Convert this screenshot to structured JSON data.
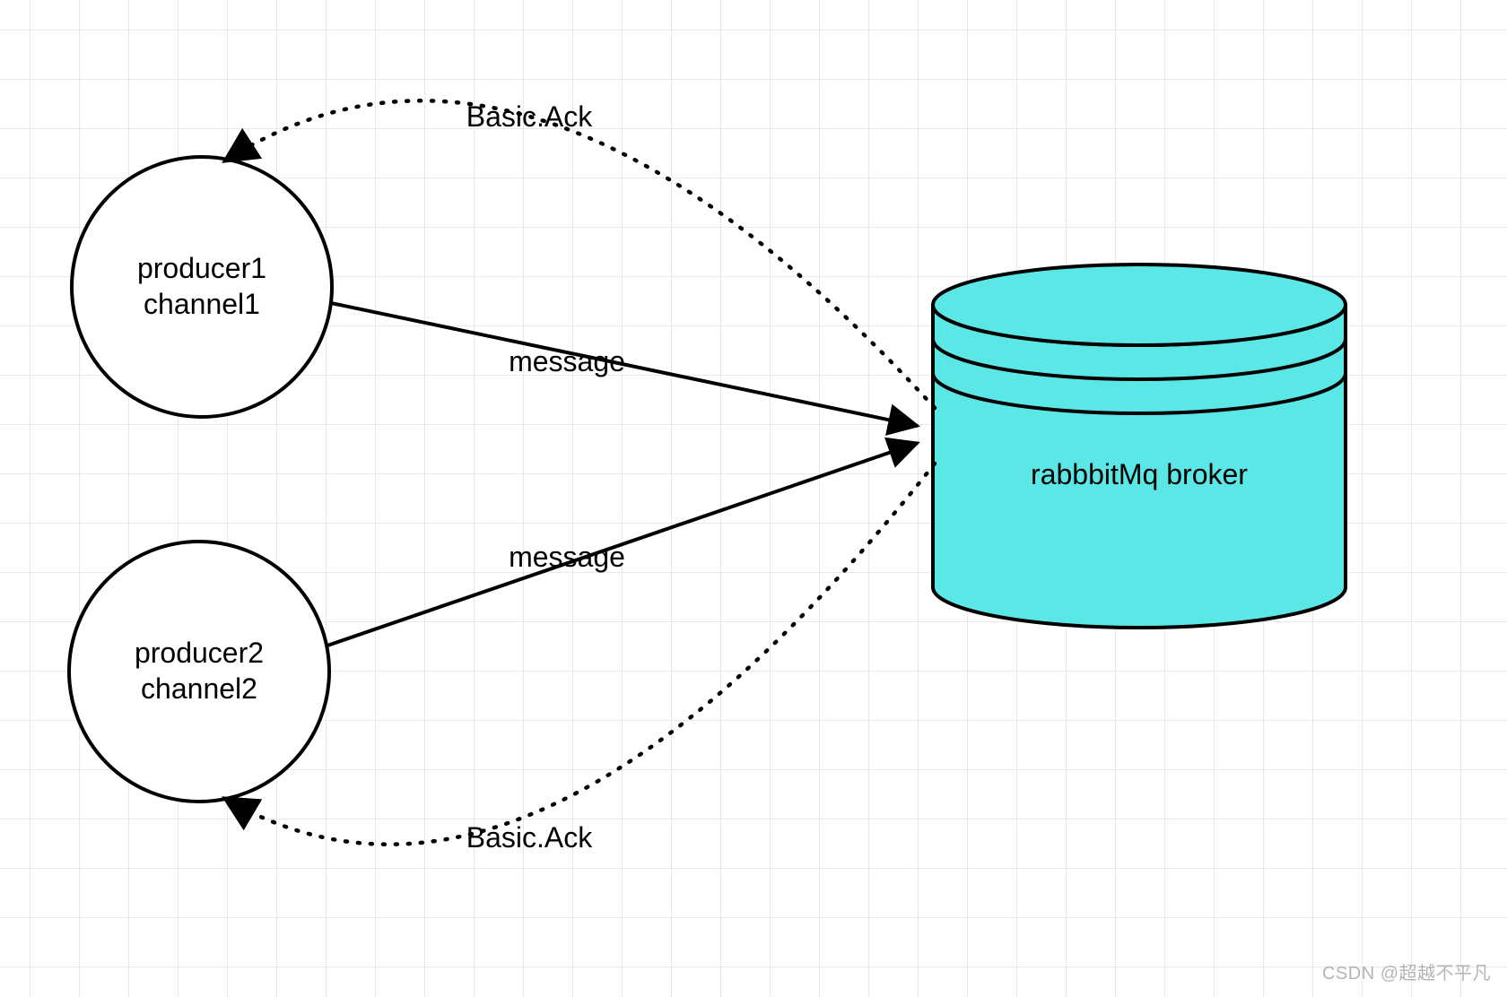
{
  "producer1": {
    "line1": "producer1",
    "line2": "channel1"
  },
  "producer2": {
    "line1": "producer2",
    "line2": "channel2"
  },
  "broker": {
    "label": "rabbbitMq broker"
  },
  "edges": {
    "msg1": "message",
    "msg2": "message",
    "ack1": "Basic.Ack",
    "ack2": "Basic.Ack"
  },
  "watermark": "CSDN @超越不平凡",
  "colors": {
    "broker_fill": "#5CE7E7",
    "stroke": "#000000"
  }
}
